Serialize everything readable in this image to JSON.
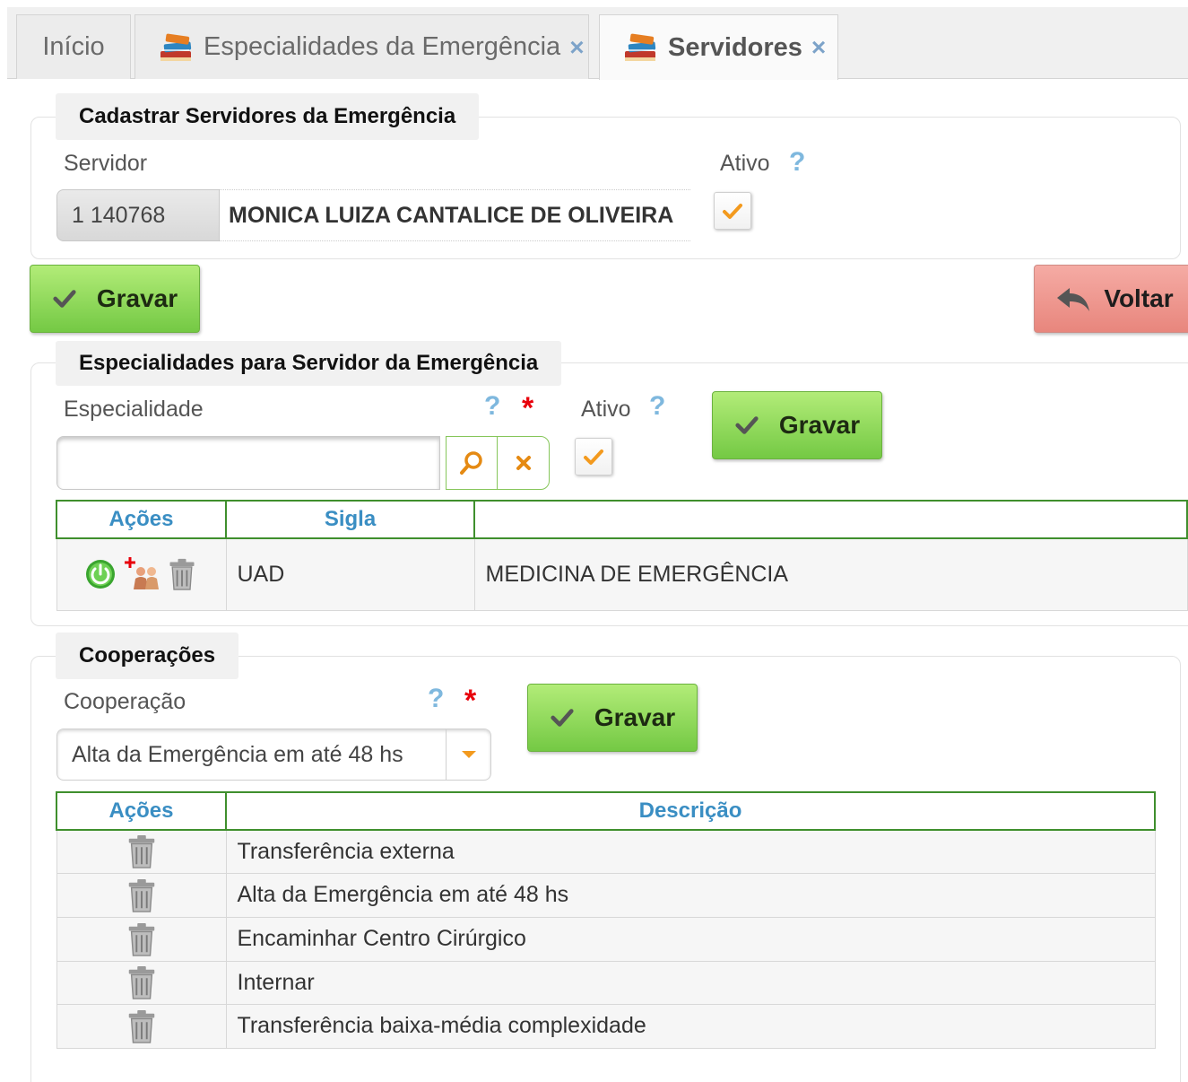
{
  "tabs": [
    {
      "label": "Início"
    },
    {
      "label": "Especialidades da Emergência",
      "close": "×"
    },
    {
      "label": "Servidores",
      "close": "×"
    }
  ],
  "cadastro": {
    "legend": "Cadastrar Servidores da Emergência",
    "servidor_label": "Servidor",
    "servidor_code": "1 140768",
    "servidor_name": "MONICA LUIZA CANTALICE DE OLIVEIRA",
    "ativo_label": "Ativo",
    "help": "?"
  },
  "buttons": {
    "gravar": "Gravar",
    "voltar": "Voltar"
  },
  "especialidades": {
    "legend": "Especialidades para Servidor da Emergência",
    "especialidade_label": "Especialidade",
    "ativo_label": "Ativo",
    "help": "?",
    "required": "*",
    "columns": [
      "Ações",
      "Sigla",
      ""
    ],
    "rows": [
      {
        "sigla": "UAD",
        "descricao": "MEDICINA DE EMERGÊNCIA"
      }
    ]
  },
  "cooperacoes": {
    "legend": "Cooperações",
    "cooperacao_label": "Cooperação",
    "help": "?",
    "required": "*",
    "selected": "Alta da Emergência em até 48 hs",
    "columns": [
      "Ações",
      "Descrição"
    ],
    "rows": [
      {
        "descricao": "Transferência externa"
      },
      {
        "descricao": "Alta da Emergência em até 48 hs"
      },
      {
        "descricao": "Encaminhar Centro Cirúrgico"
      },
      {
        "descricao": "Internar"
      },
      {
        "descricao": "Transferência baixa-média complexidade"
      }
    ]
  },
  "colors": {
    "accent_green": "#74c944",
    "header_blue": "#3a8ec3",
    "border_green": "#3f8f2d",
    "voltar_red": "#e8867d",
    "required_red": "#e8000b",
    "check_orange": "#f39a1e"
  },
  "icons": [
    "books-icon",
    "close-icon",
    "help-icon",
    "check-icon",
    "back-arrow-icon",
    "search-icon",
    "clear-icon",
    "dropdown-arrow-icon",
    "power-icon",
    "add-users-icon",
    "trash-icon"
  ]
}
